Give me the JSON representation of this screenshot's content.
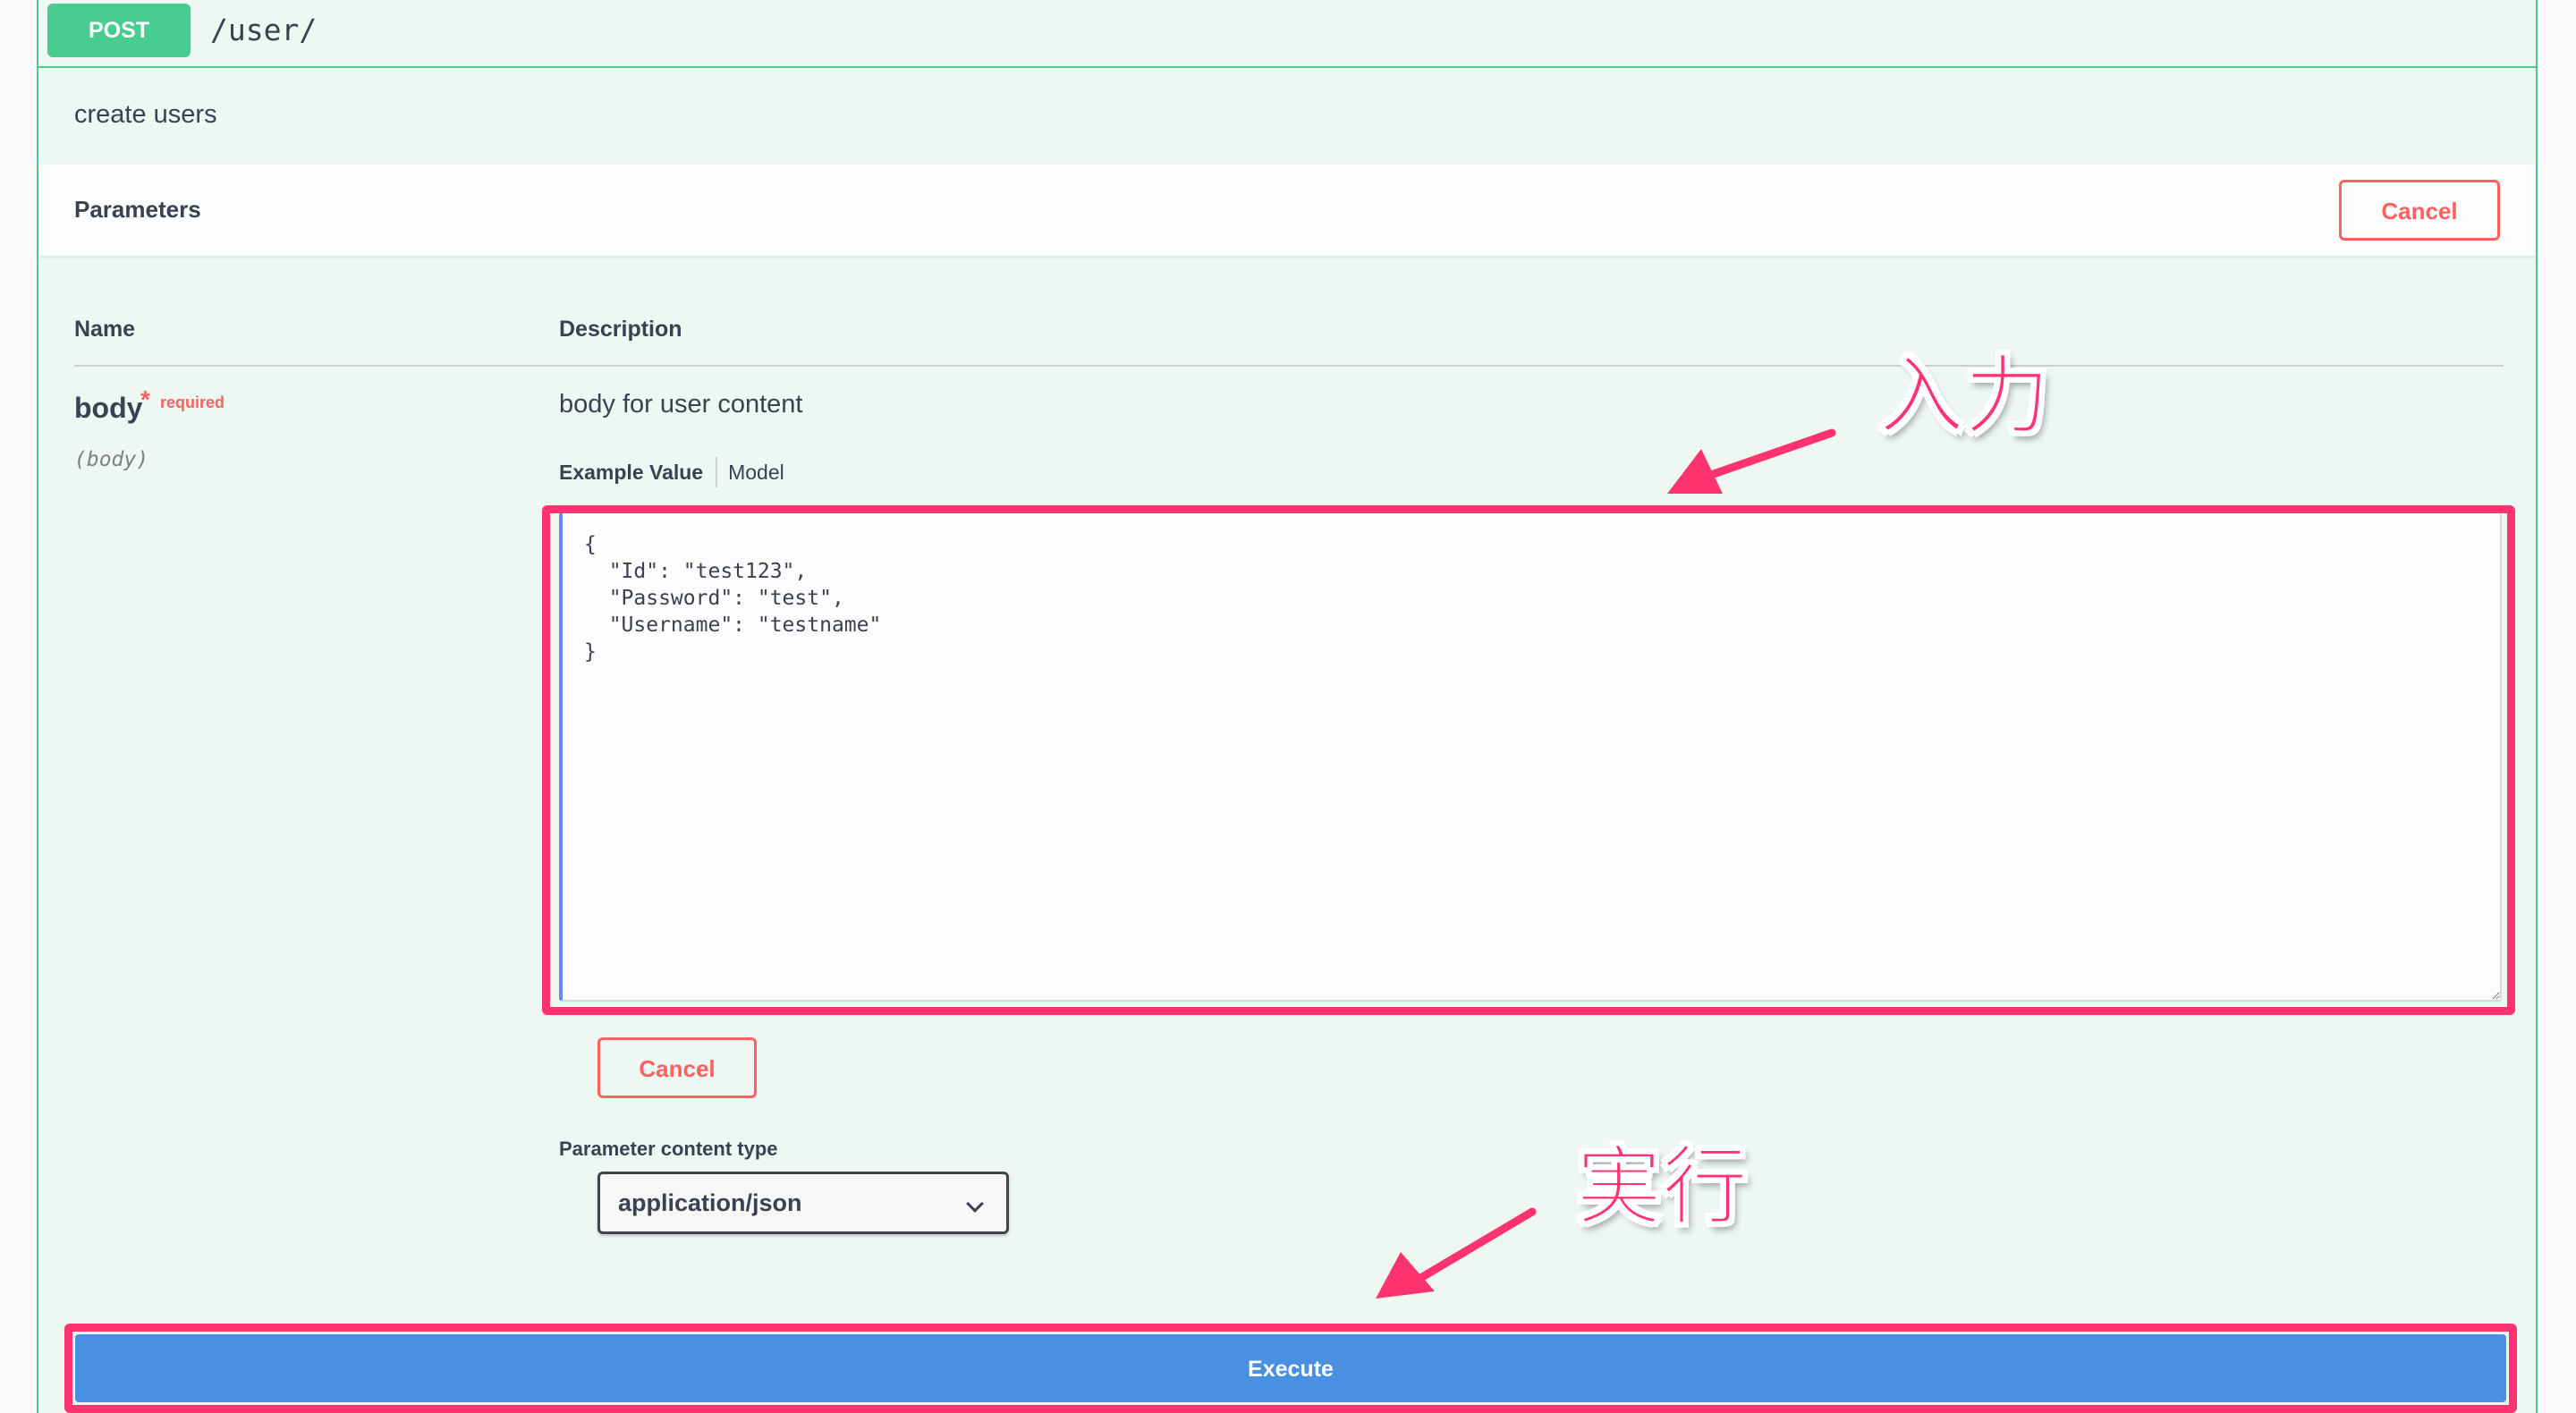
{
  "endpoint": {
    "method": "POST",
    "path": "/user/",
    "description": "create users"
  },
  "parameters": {
    "title": "Parameters",
    "cancel_label": "Cancel",
    "columns": {
      "name": "Name",
      "description": "Description"
    },
    "param": {
      "name": "body",
      "required_star": "*",
      "required_label": "required",
      "in": "(body)",
      "description": "body for user content",
      "tabs": {
        "example_value": "Example Value",
        "model": "Model"
      },
      "editor_value": "{\n  \"Id\": \"test123\",\n  \"Password\": \"test\",\n  \"Username\": \"testname\"\n}",
      "cancel_label": "Cancel"
    },
    "content_type": {
      "label": "Parameter content type",
      "selected": "application/json"
    }
  },
  "execute": {
    "label": "Execute"
  },
  "annotations": {
    "input_label": "入力",
    "execute_label": "実行",
    "highlight_color": "#ff3370"
  },
  "colors": {
    "post_green": "#49cc90",
    "execute_blue": "#4990e2",
    "cancel_red": "#ff6060"
  }
}
